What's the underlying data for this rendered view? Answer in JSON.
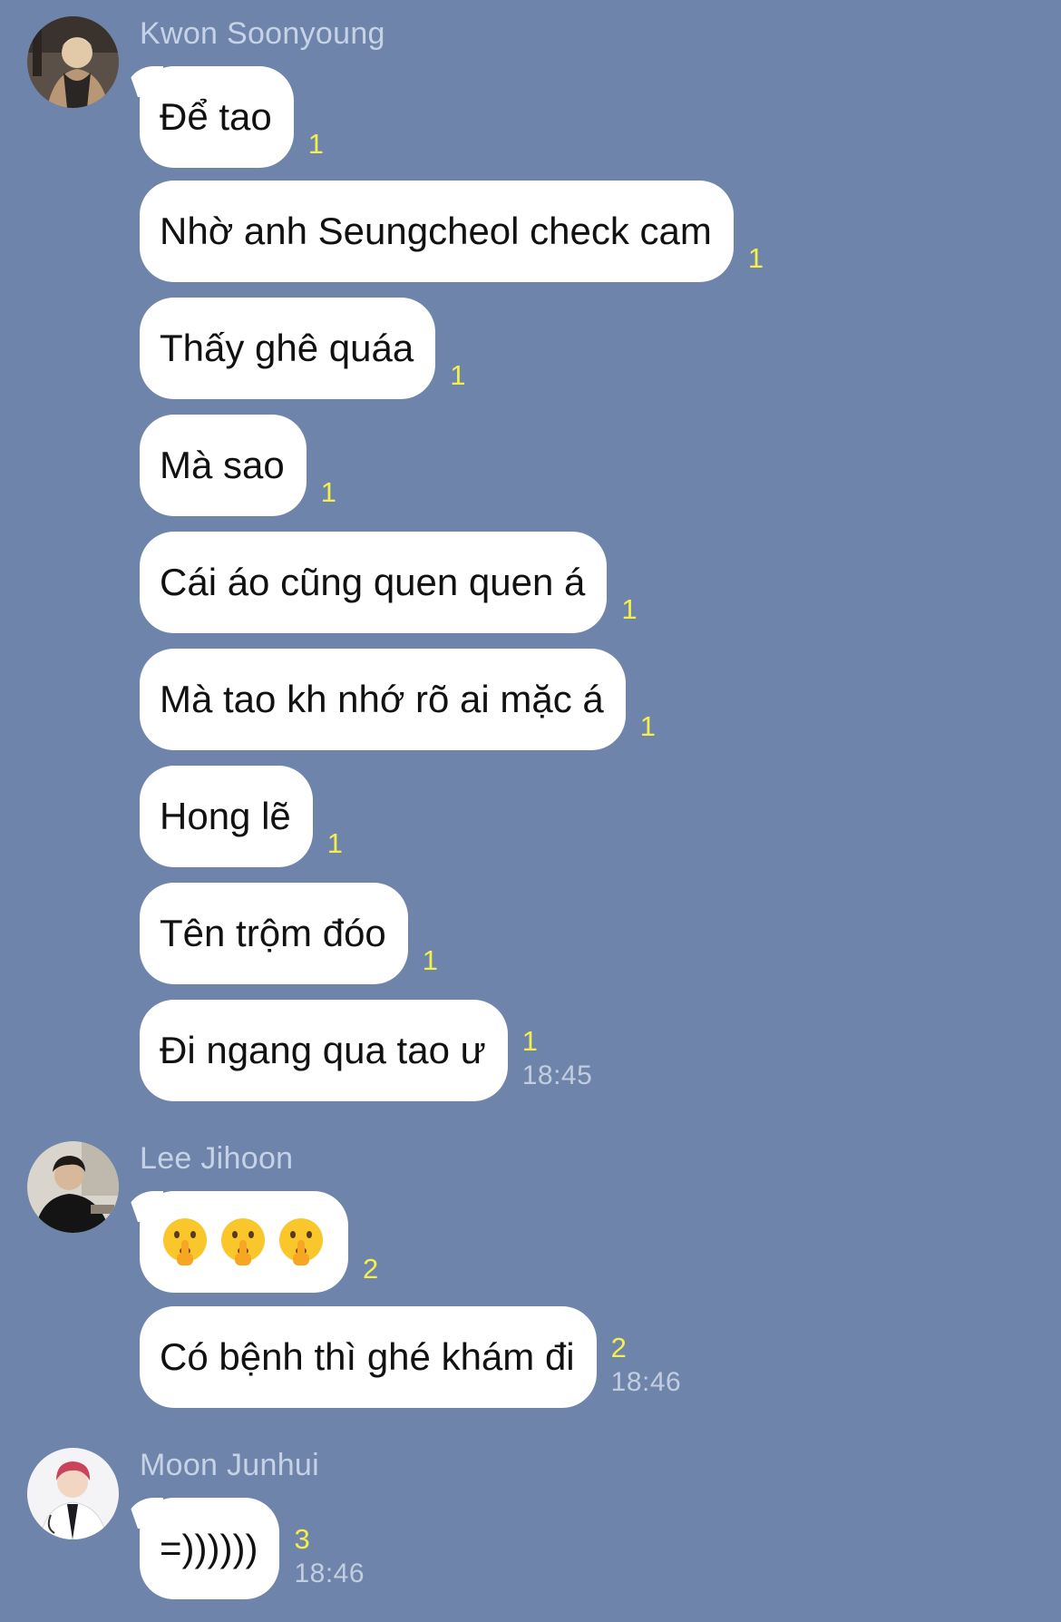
{
  "groups": [
    {
      "sender": "Kwon Soonyoung",
      "avatar_icon": "person-photo-icon",
      "messages": [
        {
          "text": "Để tao",
          "read": "1",
          "time": ""
        },
        {
          "text": "Nhờ anh Seungcheol check cam",
          "read": "1",
          "time": ""
        },
        {
          "text": "Thấy ghê quáa",
          "read": "1",
          "time": ""
        },
        {
          "text": "Mà sao",
          "read": "1",
          "time": ""
        },
        {
          "text": "Cái áo cũng quen quen á",
          "read": "1",
          "time": ""
        },
        {
          "text": "Mà tao kh nhớ rõ ai mặc á",
          "read": "1",
          "time": ""
        },
        {
          "text": "Hong lẽ",
          "read": "1",
          "time": ""
        },
        {
          "text": "Tên trộm đóo",
          "read": "1",
          "time": ""
        },
        {
          "text": "Đi ngang qua tao ư",
          "read": "1",
          "time": "18:45"
        }
      ]
    },
    {
      "sender": "Lee Jihoon",
      "avatar_icon": "person-photo-icon",
      "messages": [
        {
          "emoji": [
            "shushing-face-emoji",
            "shushing-face-emoji",
            "shushing-face-emoji"
          ],
          "read": "2",
          "time": ""
        },
        {
          "text": "Có bệnh thì ghé khám đi",
          "read": "2",
          "time": "18:46"
        }
      ]
    },
    {
      "sender": "Moon Junhui",
      "avatar_icon": "person-photo-icon",
      "messages": [
        {
          "text": "=))))))",
          "read": "3",
          "time": "18:46"
        }
      ]
    }
  ],
  "colors": {
    "background": "#6e84aa",
    "bubble": "#ffffff",
    "read_count": "#f4ef4a",
    "sender_name": "#c6d2e6",
    "timestamp": "#c3cde0"
  }
}
